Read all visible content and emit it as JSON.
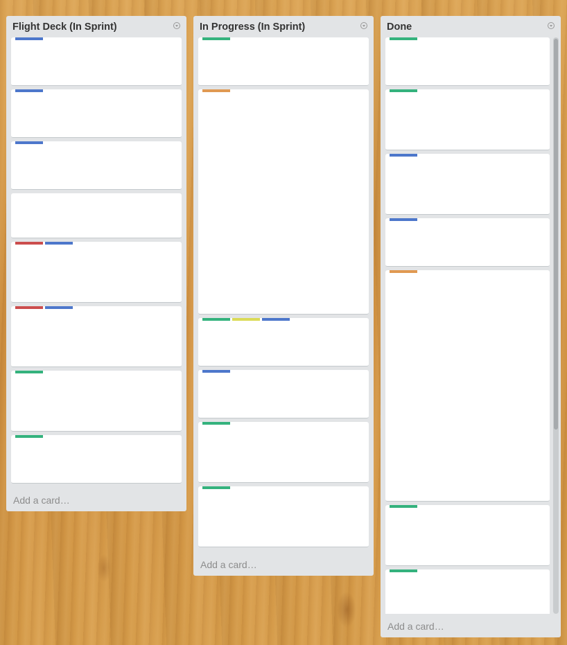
{
  "lists": [
    {
      "title": "Flight Deck (In Sprint)",
      "add_card": "Add a card…",
      "cards": [
        {
          "labels": [
            "blue"
          ]
        },
        {
          "labels": [
            "blue"
          ]
        },
        {
          "labels": [
            "blue"
          ]
        },
        {
          "labels": []
        },
        {
          "labels": [
            "red",
            "blue"
          ]
        },
        {
          "labels": [
            "red",
            "blue"
          ]
        },
        {
          "labels": [
            "green"
          ]
        },
        {
          "labels": [
            "green"
          ]
        }
      ]
    },
    {
      "title": "In Progress (In Sprint)",
      "add_card": "Add a card…",
      "cards": [
        {
          "labels": [
            "green"
          ]
        },
        {
          "labels": [
            "orange"
          ]
        },
        {
          "labels": [
            "green",
            "yellow",
            "blue"
          ]
        },
        {
          "labels": [
            "blue"
          ]
        },
        {
          "labels": [
            "green"
          ]
        },
        {
          "labels": [
            "green"
          ]
        }
      ]
    },
    {
      "title": "Done",
      "add_card": "Add a card…",
      "cards": [
        {
          "labels": [
            "green"
          ]
        },
        {
          "labels": [
            "green"
          ]
        },
        {
          "labels": [
            "blue"
          ]
        },
        {
          "labels": [
            "blue"
          ]
        },
        {
          "labels": [
            "orange"
          ]
        },
        {
          "labels": [
            "green"
          ]
        },
        {
          "labels": [
            "green"
          ]
        }
      ]
    }
  ],
  "label_colors": {
    "green": "#34b27d",
    "blue": "#4d77cb",
    "red": "#cb4d4d",
    "orange": "#e09952",
    "yellow": "#dbdb57"
  }
}
